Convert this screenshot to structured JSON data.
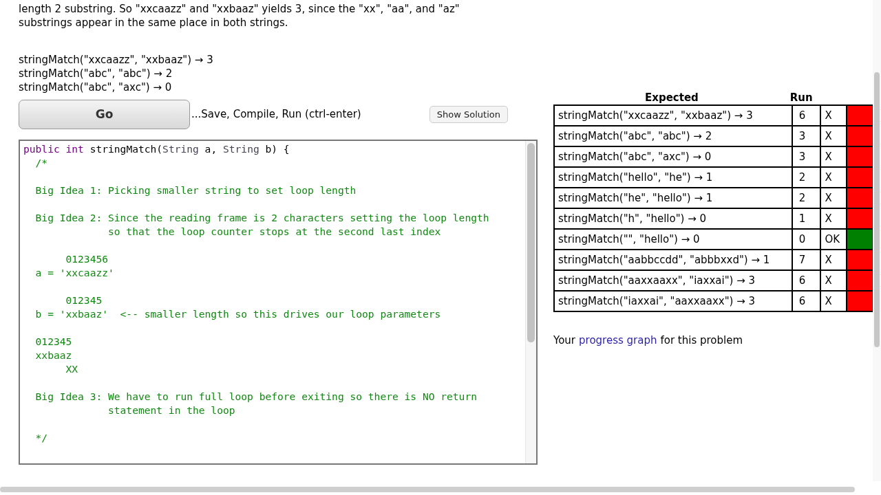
{
  "description_lines": [
    "length 2 substring. So \"xxcaazz\" and \"xxbaaz\" yields 3, since the \"xx\", \"aa\", and \"az\"",
    "substrings appear in the same place in both strings."
  ],
  "examples": [
    "stringMatch(\"xxcaazz\", \"xxbaaz\") → 3",
    "stringMatch(\"abc\", \"abc\") → 2",
    "stringMatch(\"abc\", \"axc\") → 0"
  ],
  "go_button": "Go",
  "go_hint": "...Save, Compile, Run (ctrl-enter)",
  "solution_button": "Show Solution",
  "editor": {
    "lines": [
      {
        "kind": "code",
        "tokens": [
          {
            "kind": "keyword",
            "text": "public"
          },
          {
            "kind": "keyword",
            "text": " int"
          },
          {
            "kind": "plain",
            "text": " stringMatch("
          },
          {
            "kind": "type",
            "text": "String"
          },
          {
            "kind": "plain",
            "text": " a, "
          },
          {
            "kind": "type",
            "text": "String"
          },
          {
            "kind": "plain",
            "text": " b) {"
          }
        ]
      },
      {
        "kind": "code",
        "tokens": [
          {
            "kind": "comment",
            "text": "  /*"
          }
        ]
      },
      {
        "kind": "blank"
      },
      {
        "kind": "code",
        "tokens": [
          {
            "kind": "comment",
            "text": "  Big Idea 1: Picking smaller string to set loop length"
          }
        ]
      },
      {
        "kind": "blank"
      },
      {
        "kind": "code",
        "tokens": [
          {
            "kind": "comment",
            "text": "  Big Idea 2: Since the reading frame is 2 characters setting the loop length"
          }
        ]
      },
      {
        "kind": "code",
        "tokens": [
          {
            "kind": "comment",
            "text": "              so that the loop counter stops at the second last index"
          }
        ]
      },
      {
        "kind": "blank"
      },
      {
        "kind": "code",
        "tokens": [
          {
            "kind": "comment",
            "text": "       0123456"
          }
        ]
      },
      {
        "kind": "code",
        "tokens": [
          {
            "kind": "comment",
            "text": "  a = 'xxcaazz'"
          }
        ]
      },
      {
        "kind": "blank"
      },
      {
        "kind": "code",
        "tokens": [
          {
            "kind": "comment",
            "text": "       012345"
          }
        ]
      },
      {
        "kind": "code",
        "tokens": [
          {
            "kind": "comment",
            "text": "  b = 'xxbaaz'  <-- smaller length so this drives our loop parameters"
          }
        ]
      },
      {
        "kind": "blank"
      },
      {
        "kind": "code",
        "tokens": [
          {
            "kind": "comment",
            "text": "  012345"
          }
        ]
      },
      {
        "kind": "code",
        "tokens": [
          {
            "kind": "comment",
            "text": "  xxbaaz"
          }
        ]
      },
      {
        "kind": "code",
        "tokens": [
          {
            "kind": "comment",
            "text": "       XX"
          }
        ]
      },
      {
        "kind": "blank"
      },
      {
        "kind": "code",
        "tokens": [
          {
            "kind": "comment",
            "text": "  Big Idea 3: We have to run full loop before exiting so there is NO return"
          }
        ]
      },
      {
        "kind": "code",
        "tokens": [
          {
            "kind": "comment",
            "text": "              statement in the loop"
          }
        ]
      },
      {
        "kind": "blank"
      },
      {
        "kind": "code",
        "tokens": [
          {
            "kind": "comment",
            "text": "  */"
          }
        ]
      }
    ]
  },
  "results": {
    "columns": [
      "Expected",
      "Run"
    ],
    "rows": [
      {
        "expected": "stringMatch(\"xxcaazz\", \"xxbaaz\") → 3",
        "run": "6",
        "verdict": "X",
        "passed": false
      },
      {
        "expected": "stringMatch(\"abc\", \"abc\") → 2",
        "run": "3",
        "verdict": "X",
        "passed": false
      },
      {
        "expected": "stringMatch(\"abc\", \"axc\") → 0",
        "run": "3",
        "verdict": "X",
        "passed": false
      },
      {
        "expected": "stringMatch(\"hello\", \"he\") → 1",
        "run": "2",
        "verdict": "X",
        "passed": false
      },
      {
        "expected": "stringMatch(\"he\", \"hello\") → 1",
        "run": "2",
        "verdict": "X",
        "passed": false
      },
      {
        "expected": "stringMatch(\"h\", \"hello\") → 0",
        "run": "1",
        "verdict": "X",
        "passed": false
      },
      {
        "expected": "stringMatch(\"\", \"hello\") → 0",
        "run": "0",
        "verdict": "OK",
        "passed": true
      },
      {
        "expected": "stringMatch(\"aabbccdd\", \"abbbxxd\") → 1",
        "run": "7",
        "verdict": "X",
        "passed": false
      },
      {
        "expected": "stringMatch(\"aaxxaaxx\", \"iaxxai\") → 3",
        "run": "6",
        "verdict": "X",
        "passed": false
      },
      {
        "expected": "stringMatch(\"iaxxai\", \"aaxxaaxx\") → 3",
        "run": "6",
        "verdict": "X",
        "passed": false
      }
    ]
  },
  "progress": {
    "before": "Your",
    "link": "progress graph",
    "after": "for this problem"
  }
}
